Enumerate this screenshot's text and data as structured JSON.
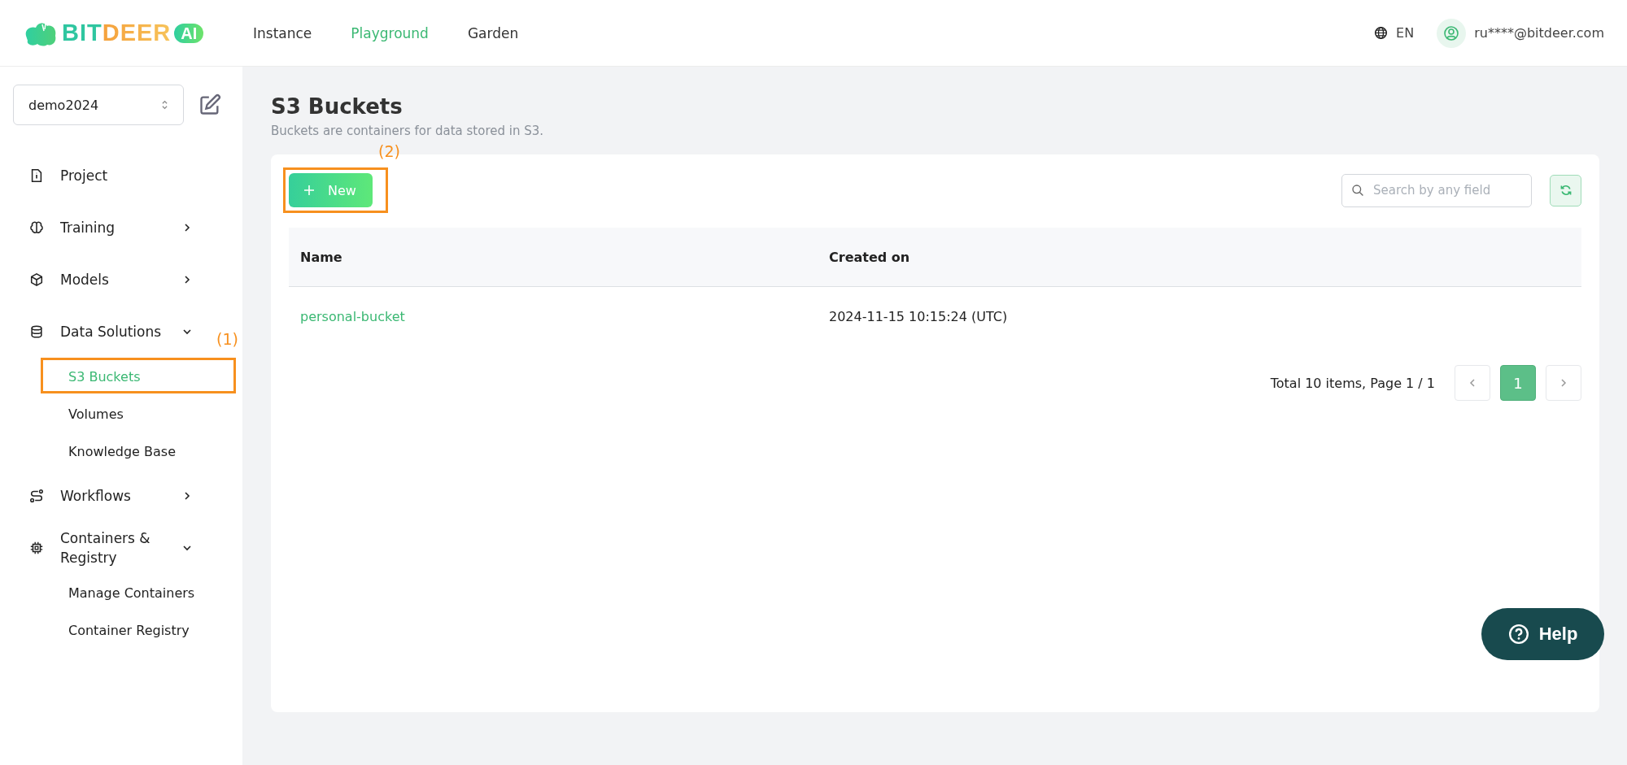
{
  "header": {
    "logo": {
      "name_1": "BIT",
      "name_2": "DEER",
      "badge": "AI"
    },
    "nav": [
      {
        "label": "Instance",
        "selected": false
      },
      {
        "label": "Playground",
        "selected": true
      },
      {
        "label": "Garden",
        "selected": false
      }
    ],
    "language": "EN",
    "user": "ru****@bitdeer.com"
  },
  "sidebar": {
    "project_select": "demo2024",
    "items": [
      {
        "label": "Project"
      },
      {
        "label": "Training",
        "expanded": false
      },
      {
        "label": "Models",
        "expanded": false
      },
      {
        "label": "Data Solutions",
        "expanded": true,
        "children": [
          {
            "label": "S3 Buckets",
            "selected": true,
            "annotation": "(1)"
          },
          {
            "label": "Volumes",
            "selected": false
          },
          {
            "label": "Knowledge Base",
            "selected": false
          }
        ]
      },
      {
        "label": "Workflows",
        "expanded": false
      },
      {
        "label": "Containers & Registry",
        "expanded": true,
        "children": [
          {
            "label": "Manage Containers",
            "selected": false
          },
          {
            "label": "Container Registry",
            "selected": false
          }
        ]
      }
    ]
  },
  "page": {
    "title": "S3 Buckets",
    "subtitle": "Buckets are containers for data stored in S3.",
    "new_button": {
      "label": "New",
      "annotation": "(2)"
    },
    "search": {
      "placeholder": "Search by any field"
    },
    "table": {
      "columns": [
        "Name",
        "Created on"
      ],
      "rows": [
        [
          "personal-bucket",
          "2024-11-15 10:15:24 (UTC)"
        ]
      ]
    },
    "pagination": {
      "summary": "Total 10 items, Page 1 / 1",
      "pages": [
        {
          "label": "1",
          "selected": true
        }
      ]
    }
  },
  "help_button": {
    "label": "Help"
  }
}
